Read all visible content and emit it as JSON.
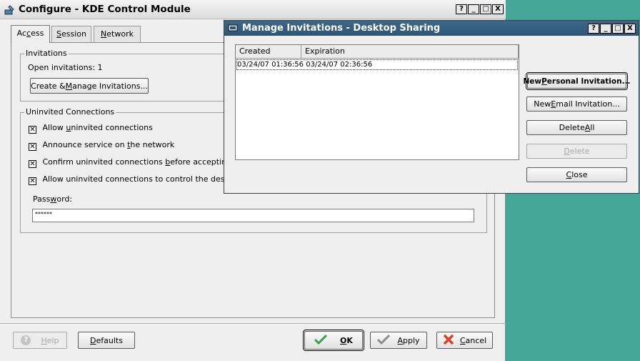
{
  "main": {
    "title": "Configure - KDE Control Module",
    "title_buttons": [
      "?",
      "_",
      "□",
      "X"
    ],
    "tabs": [
      {
        "label": "Access",
        "u": "c",
        "pre": "Ac",
        "post": "ess"
      },
      {
        "label": "Session",
        "pre": "",
        "u": "S",
        "post": "ession"
      },
      {
        "label": "Network",
        "pre": "",
        "u": "N",
        "post": "etwork"
      }
    ],
    "invitations": {
      "group_label": "Invitations",
      "open_text": "Open invitations: 1",
      "manage_btn": {
        "pre": "Create & ",
        "u": "M",
        "post": "anage Invitations..."
      }
    },
    "uninvited": {
      "group_label": "Uninvited Connections",
      "options": [
        {
          "pre": "Allow ",
          "u": "u",
          "post": "ninvited connections",
          "checked": true
        },
        {
          "pre": "Announce service on ",
          "u": "t",
          "post": "he network",
          "checked": true
        },
        {
          "pre": "Confirm uninvited connections ",
          "u": "b",
          "post": "efore accepting",
          "checked": true
        },
        {
          "pre": "Allow uninvited connections to control the desktop",
          "u": "",
          "post": "",
          "checked": true
        }
      ],
      "password_label": {
        "pre": "Pass",
        "u": "w",
        "post": "ord:"
      },
      "password_value": "******"
    },
    "bottom_buttons": {
      "help": {
        "pre": "",
        "u": "H",
        "post": "elp"
      },
      "defaults": {
        "pre": "",
        "u": "D",
        "post": "efaults"
      },
      "ok": {
        "pre": "",
        "u": "O",
        "post": "K"
      },
      "apply": {
        "pre": "",
        "u": "A",
        "post": "pply"
      },
      "cancel": {
        "pre": "",
        "u": "C",
        "post": "ancel"
      }
    }
  },
  "dialog": {
    "title": "Manage Invitations - Desktop Sharing",
    "title_buttons": [
      "?",
      "_",
      "□",
      "X"
    ],
    "columns": [
      "Created",
      "Expiration"
    ],
    "rows": [
      {
        "created": "03/24/07 01:36:56",
        "expiration": "03/24/07 02:36:56"
      }
    ],
    "buttons": {
      "new_personal": {
        "pre": "New ",
        "u": "P",
        "post": "ersonal Invitation..."
      },
      "new_email": {
        "pre": "New ",
        "u": "E",
        "post": "mail Invitation..."
      },
      "delete_all": {
        "pre": "Delete ",
        "u": "A",
        "post": "ll"
      },
      "delete": {
        "pre": "",
        "u": "D",
        "post": "elete"
      },
      "close": {
        "pre": "",
        "u": "C",
        "post": "lose"
      }
    }
  },
  "colors": {
    "desktop": "#44a696",
    "dialog_title_bar": "#2d5576",
    "ok_check": "#3aa14a",
    "cancel_x": "#d8422a"
  }
}
